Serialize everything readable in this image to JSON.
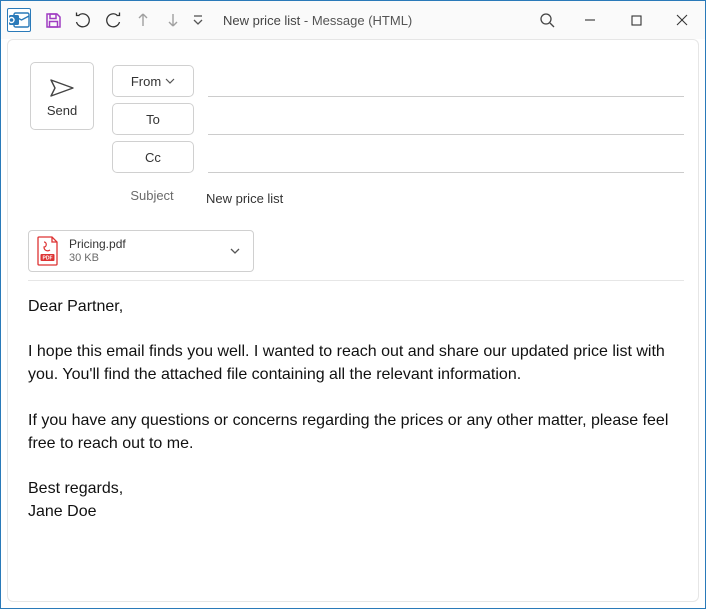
{
  "title": {
    "subject": "New price list",
    "suffix": " - Message (HTML)"
  },
  "header": {
    "send_label": "Send",
    "from_label": "From",
    "to_label": "To",
    "cc_label": "Cc",
    "subject_label": "Subject",
    "subject_value": "New price list",
    "to_value": "",
    "cc_value": ""
  },
  "attachment": {
    "name": "Pricing.pdf",
    "size": "30 KB"
  },
  "body": {
    "p1": "Dear Partner,",
    "p2": "I hope this email finds you well. I wanted to reach out and share our updated price list with you. You'll find the attached file containing all the relevant information.",
    "p3": "If you have any questions or concerns regarding the prices or any other matter, please feel free to reach out to me.",
    "p4": "Best regards,",
    "p5": "Jane Doe"
  },
  "colors": {
    "accent": "#2a7ab9"
  }
}
